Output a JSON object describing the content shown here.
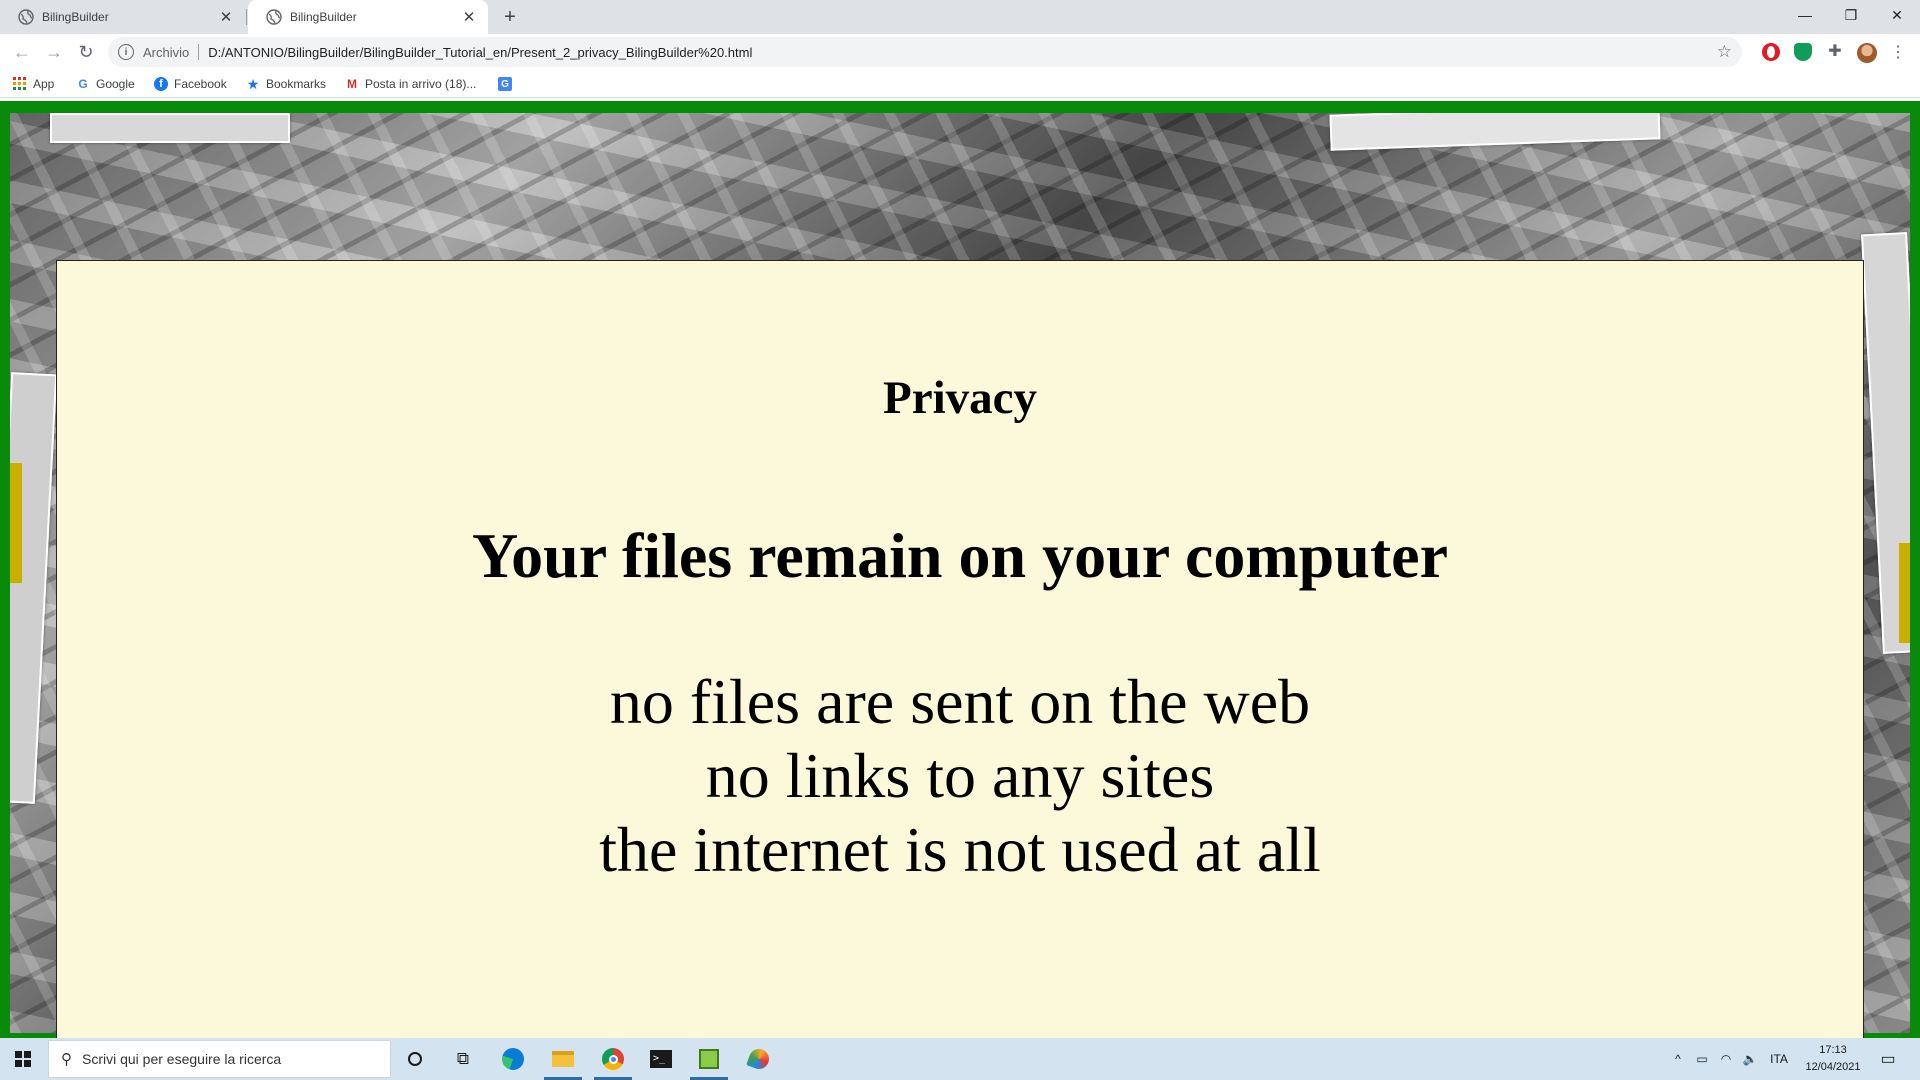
{
  "browser": {
    "tabs": [
      {
        "title": "BilingBuilder",
        "active": false
      },
      {
        "title": "BilingBuilder",
        "active": true
      }
    ],
    "new_tab_symbol": "+",
    "window_controls": {
      "minimize": "—",
      "restore": "❐",
      "close": "✕"
    },
    "address_bar": {
      "scheme_label": "Archivio",
      "url": "D:/ANTONIO/BilingBuilder/BilingBuilder_Tutorial_en/Present_2_privacy_BilingBuilder%20.html"
    },
    "bookmarks": [
      {
        "label": "App",
        "icon": "apps-grid-icon"
      },
      {
        "label": "Google",
        "icon": "google-icon"
      },
      {
        "label": "Facebook",
        "icon": "facebook-icon"
      },
      {
        "label": "Bookmarks",
        "icon": "star-icon"
      },
      {
        "label": "Posta in arrivo (18)...",
        "icon": "gmail-icon"
      },
      {
        "label": "",
        "icon": "translate-icon"
      }
    ],
    "extensions": [
      "opera-icon",
      "shield-icon",
      "puzzle-icon",
      "profile-avatar"
    ]
  },
  "page": {
    "heading": "Privacy",
    "subheading": "Your files remain on your computer",
    "lines": [
      "no files are sent on the web",
      "no links to any sites",
      "the internet is not used at all"
    ],
    "colors": {
      "frame": "#0a8a0a",
      "card_background": "#fcf8da"
    }
  },
  "taskbar": {
    "search_placeholder": "Scrivi qui per eseguire la ricerca",
    "apps": [
      "cortana-icon",
      "task-view-icon",
      "edge-icon",
      "file-explorer-icon",
      "chrome-icon",
      "terminal-icon",
      "notepad-icon",
      "paint-icon"
    ],
    "tray": {
      "language": "ITA",
      "time": "17:13",
      "date": "12/04/2021"
    }
  }
}
